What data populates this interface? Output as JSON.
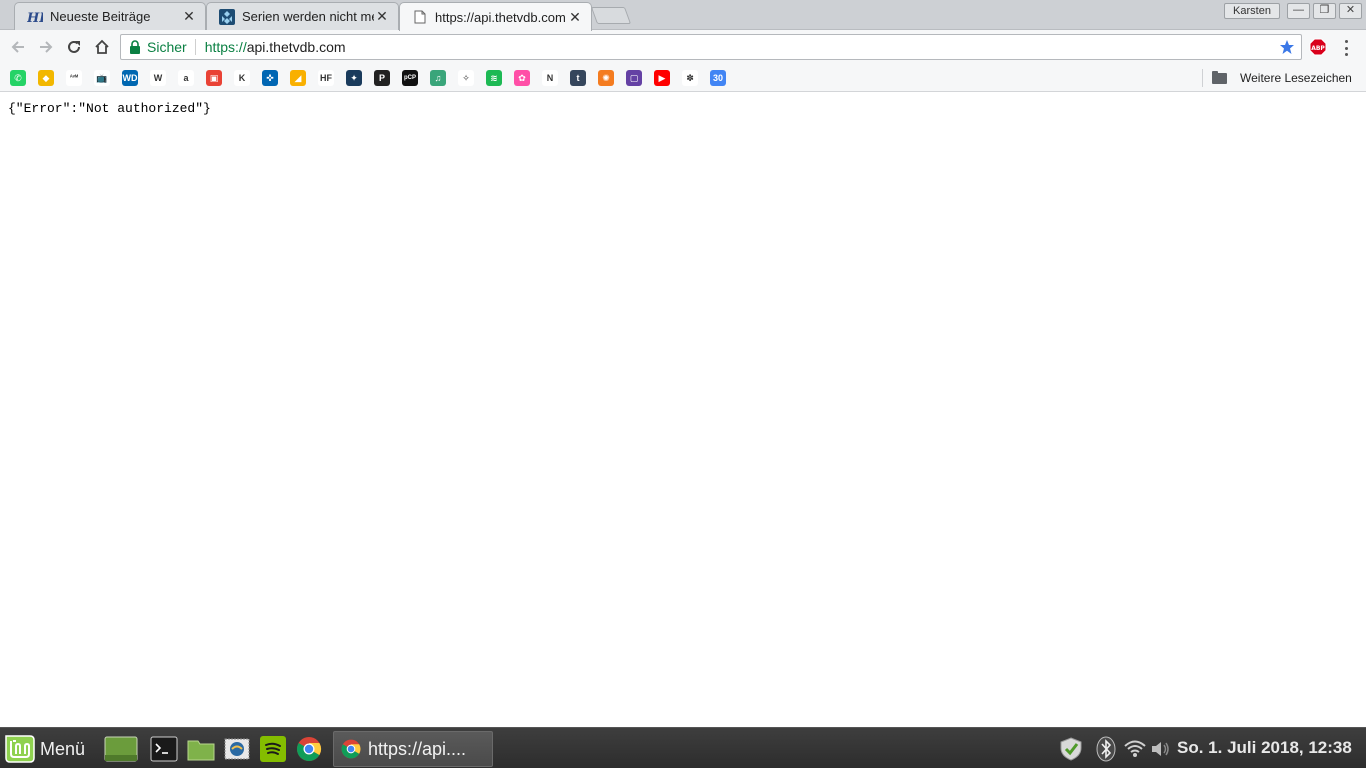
{
  "tabs": [
    {
      "title": "Neueste Beiträge",
      "favicon": "hf-icon",
      "active": false
    },
    {
      "title": "Serien werden nicht mehr",
      "favicon": "kodi-icon",
      "active": false
    },
    {
      "title": "https://api.thetvdb.com",
      "favicon": "page-icon",
      "active": true
    }
  ],
  "window": {
    "profile_name": "Karsten",
    "minimize": "—",
    "restore": "❐",
    "close": "✕"
  },
  "toolbar": {
    "secure_label": "Sicher",
    "url_scheme": "https://",
    "url_host": "api.thetvdb.com",
    "abp_label": "ABP"
  },
  "bookmarks": {
    "items": [
      {
        "icon": "whatsapp-icon",
        "color": "#25d366",
        "glyph": "✆"
      },
      {
        "icon": "lotto-icon",
        "color": "#f2b700",
        "glyph": "◆"
      },
      {
        "icon": "avm-icon",
        "color": "#ffffff",
        "glyph": "ᴬᵛᴹ"
      },
      {
        "icon": "tv-icon",
        "color": "#ffffff",
        "glyph": "📺"
      },
      {
        "icon": "wd-icon",
        "color": "#0067b1",
        "glyph": "WD"
      },
      {
        "icon": "wikipedia-icon",
        "color": "#ffffff",
        "glyph": "W"
      },
      {
        "icon": "amazon-icon",
        "color": "#ffffff",
        "glyph": "a"
      },
      {
        "icon": "shopping-bag-icon",
        "color": "#e94235",
        "glyph": "▣"
      },
      {
        "icon": "k-icon",
        "color": "#ffffff",
        "glyph": "K"
      },
      {
        "icon": "volksbank-icon",
        "color": "#0066b3",
        "glyph": "✜"
      },
      {
        "icon": "sparkasse-icon",
        "color": "#f9b000",
        "glyph": "◢"
      },
      {
        "icon": "hf-bookmark-icon",
        "color": "#ffffff",
        "glyph": "HF"
      },
      {
        "icon": "kodi-bookmark-icon",
        "color": "#1a3b5c",
        "glyph": "✦"
      },
      {
        "icon": "p-icon",
        "color": "#222222",
        "glyph": "P"
      },
      {
        "icon": "pcp-icon",
        "color": "#111111",
        "glyph": "pCP"
      },
      {
        "icon": "music-icon",
        "color": "#3aa57a",
        "glyph": "♫"
      },
      {
        "icon": "kodi-icon",
        "color": "#ffffff",
        "glyph": "✧"
      },
      {
        "icon": "spotify-icon",
        "color": "#1db954",
        "glyph": "≋"
      },
      {
        "icon": "flower-icon",
        "color": "#ff4fa7",
        "glyph": "✿"
      },
      {
        "icon": "netflix-icon",
        "color": "#ffffff",
        "glyph": "N"
      },
      {
        "icon": "tumblr-icon",
        "color": "#35465c",
        "glyph": "t"
      },
      {
        "icon": "sun-icon",
        "color": "#f47c20",
        "glyph": "✺"
      },
      {
        "icon": "twitch-icon",
        "color": "#6441a4",
        "glyph": "▢"
      },
      {
        "icon": "youtube-icon",
        "color": "#ff0000",
        "glyph": "▶"
      },
      {
        "icon": "photos-icon",
        "color": "#ffffff",
        "glyph": "✽"
      },
      {
        "icon": "calendar-icon",
        "color": "#4285f4",
        "glyph": "30"
      }
    ],
    "other_label": "Weitere Lesezeichen"
  },
  "content": {
    "json_text": "{\"Error\":\"Not authorized\"}"
  },
  "taskbar": {
    "menu_label": "Menü",
    "window_title": "https://api....",
    "clock": "So.  1. Juli 2018, 12:38"
  }
}
